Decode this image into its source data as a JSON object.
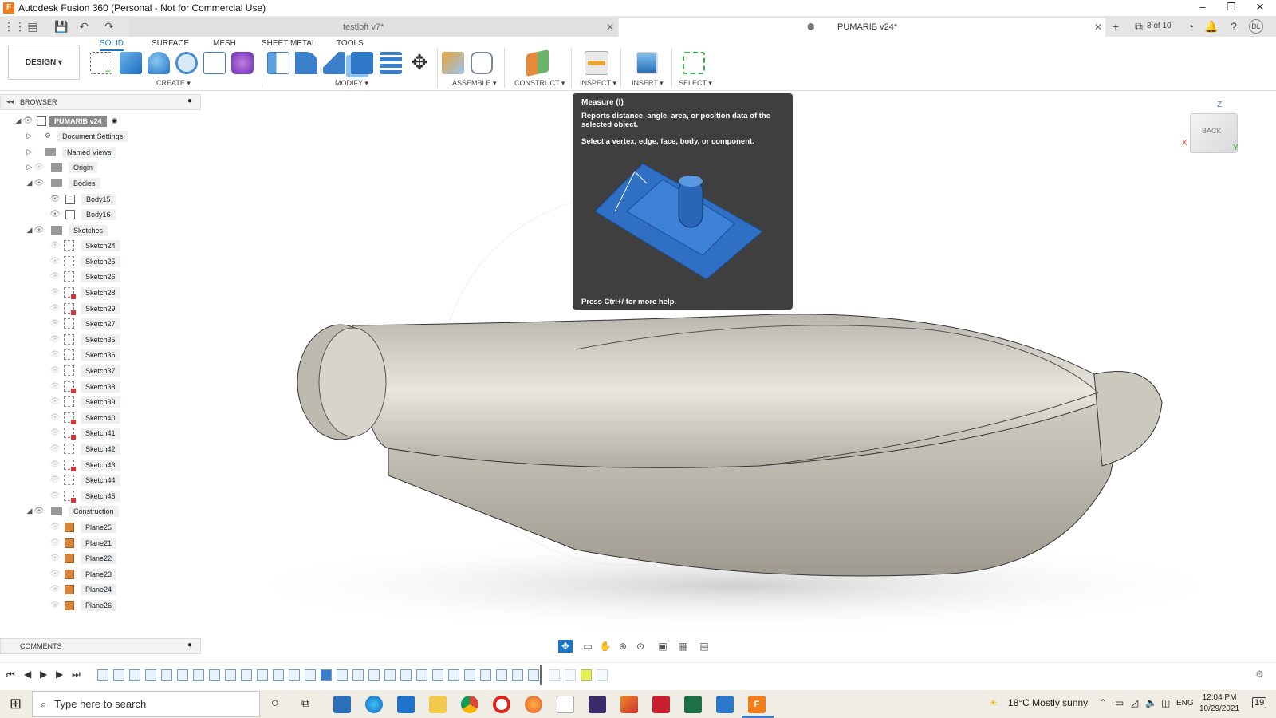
{
  "window": {
    "title": "Autodesk Fusion 360 (Personal - Not for Commercial Use)"
  },
  "tabs": [
    {
      "label": "testloft v7*",
      "active": false
    },
    {
      "label": "PUMARIB v24*",
      "active": true
    }
  ],
  "header": {
    "page_count": "8 of 10",
    "user_initials": "DL"
  },
  "ribbon": {
    "tabs": [
      "SOLID",
      "SURFACE",
      "MESH",
      "SHEET METAL",
      "TOOLS"
    ],
    "workspace": "DESIGN ▾",
    "groups": [
      "CREATE ▾",
      "MODIFY ▾",
      "ASSEMBLE ▾",
      "CONSTRUCT ▾",
      "INSPECT ▾",
      "INSERT ▾",
      "SELECT ▾"
    ]
  },
  "browser": {
    "title": "BROWSER",
    "root": "PUMARIB v24",
    "items": [
      "Document Settings",
      "Named Views",
      "Origin",
      "Bodies",
      "Body15",
      "Body16",
      "Sketches",
      "Sketch24",
      "Sketch25",
      "Sketch26",
      "Sketch28",
      "Sketch29",
      "Sketch27",
      "Sketch35",
      "Sketch36",
      "Sketch37",
      "Sketch38",
      "Sketch39",
      "Sketch40",
      "Sketch41",
      "Sketch42",
      "Sketch43",
      "Sketch44",
      "Sketch45",
      "Construction",
      "Plane25",
      "Plane21",
      "Plane22",
      "Plane23",
      "Plane24",
      "Plane26"
    ]
  },
  "comments": {
    "title": "COMMENTS"
  },
  "tooltip": {
    "title": "Measure (I)",
    "description": "Reports distance, angle, area, or position data of the selected object.",
    "hint": "Select a vertex, edge, face, body, or component.",
    "footer": "Press Ctrl+/ for more help."
  },
  "viewcube": {
    "face": "BACK",
    "z": "Z",
    "x": "X",
    "y": "Y"
  },
  "taskbar": {
    "search_placeholder": "Type here to search",
    "weather": "18°C  Mostly sunny",
    "lang": "ENG",
    "time": "12:04 PM",
    "date": "10/29/2021",
    "notifications": "19"
  },
  "colors": {
    "accent": "#1a75c4",
    "model": "#c9c5bb",
    "tooltip_bg": "#3f3f3f",
    "sketch_warn": "#d33333"
  }
}
